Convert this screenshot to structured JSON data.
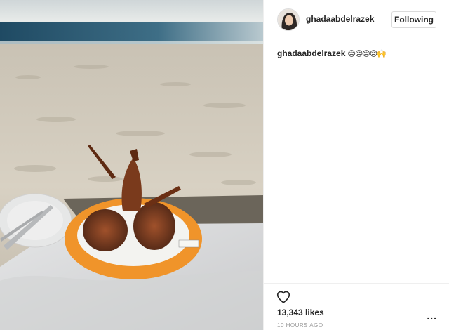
{
  "post": {
    "username": "ghadaabdelrazek",
    "follow_label": "Following",
    "caption_user": "ghadaabdelrazek",
    "caption_text": "😔😔😔😔🙌",
    "likes": "13,343 likes",
    "timestamp": "10 HOURS AGO",
    "more_label": "...",
    "photo_subject": "grilled lobster on orange plate on a beach table"
  },
  "icons": {
    "like": "heart-icon",
    "options": "more-options-icon"
  },
  "colors": {
    "sand": "#d8d2c6",
    "sea": "#2f5a72",
    "plate": "#f0942a",
    "tablecloth": "#d9dadb"
  }
}
